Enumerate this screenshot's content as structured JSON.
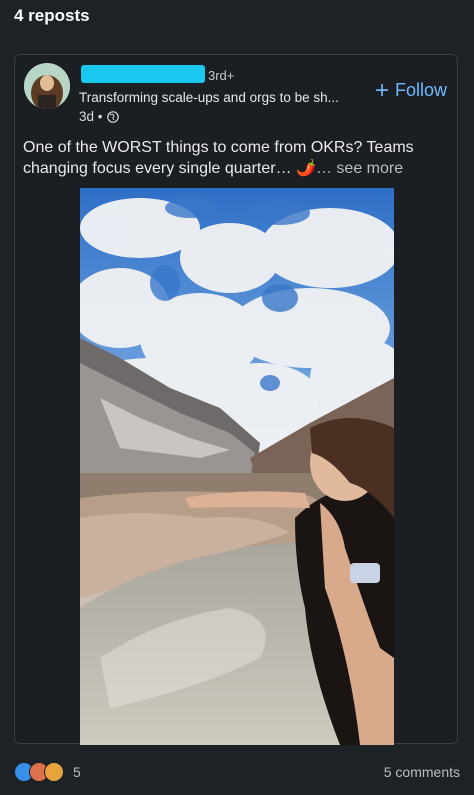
{
  "header": {
    "reposts_label": "4 reposts"
  },
  "post": {
    "author_degree": "3rd+",
    "author_headline": "Transforming scale-ups and orgs to be sh...",
    "time": "3d •",
    "follow_label": "Follow",
    "text": "One of the WORST things to come from OKRs? Teams changing focus every single quarter… 🌶️",
    "see_more": "… see more"
  },
  "footer": {
    "reaction_count": "5",
    "comments_label": "5 comments"
  },
  "colors": {
    "background": "#1d2226",
    "accent": "#71b7fb",
    "redaction": "#19c7ef"
  }
}
